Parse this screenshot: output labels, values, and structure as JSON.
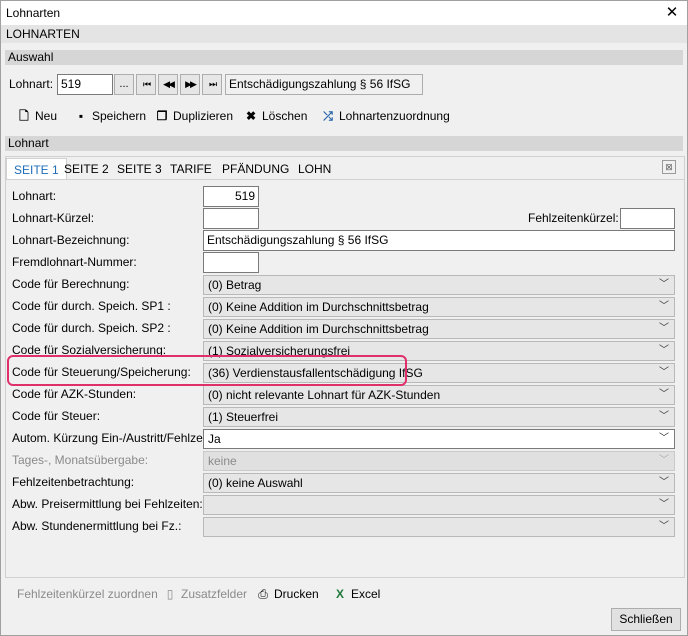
{
  "window": {
    "title": "Lohnarten",
    "close_glyph": "✕"
  },
  "header": {
    "label": "LOHNARTEN"
  },
  "auswahl": {
    "section_label": "Auswahl",
    "lohnart_label": "Lohnart:",
    "lohnart_value": "519",
    "browse_label": "...",
    "nav": [
      "⏮",
      "◀◀",
      "▶▶",
      "⏭"
    ],
    "description": "Entschädigungszahlung § 56 IfSG"
  },
  "toolbar": {
    "neu": "Neu",
    "speichern": "Speichern",
    "duplizieren": "Duplizieren",
    "loeschen": "Löschen",
    "zuordnung": "Lohnartenzuordnung"
  },
  "lohnart_section": {
    "label": "Lohnart"
  },
  "tabs": [
    "SEITE 1",
    "SEITE 2",
    "SEITE 3",
    "TARIFE",
    "PFÄNDUNG",
    "LOHN"
  ],
  "form": {
    "lohnart_label": "Lohnart:",
    "lohnart_value": "519",
    "kuerzel_label": "Lohnart-Kürzel:",
    "kuerzel_value": "",
    "fehlzeiten_label": "Fehlzeitenkürzel:",
    "fehlzeiten_value": "",
    "bezeichnung_label": "Lohnart-Bezeichnung:",
    "bezeichnung_value": "Entschädigungszahlung § 56 IfSG",
    "fremd_label": "Fremdlohnart-Nummer:",
    "fremd_value": "",
    "rows": [
      {
        "label": "Code für Berechnung:",
        "value": "(0) Betrag"
      },
      {
        "label": "Code für durch. Speich. SP1 :",
        "value": "(0) Keine Addition im Durchschnittsbetrag"
      },
      {
        "label": "Code für durch. Speich. SP2 :",
        "value": "(0) Keine Addition im Durchschnittsbetrag"
      },
      {
        "label": "Code für Sozialversicherung:",
        "value": "(1) Sozialversicherungsfrei"
      },
      {
        "label": "Code für Steuerung/Speicherung:",
        "value": "(36) Verdienstausfallentschädigung IfSG"
      },
      {
        "label": "Code für AZK-Stunden:",
        "value": "(0) nicht relevante Lohnart für AZK-Stunden"
      },
      {
        "label": "Code für Steuer:",
        "value": "(1) Steuerfrei"
      },
      {
        "label": "Autom. Kürzung Ein-/Austritt/Fehlzeit:",
        "value": "Ja"
      },
      {
        "label": "Tages-, Monatsübergabe:",
        "value": "keine"
      },
      {
        "label": "Fehlzeitenbetrachtung:",
        "value": "(0) keine Auswahl"
      },
      {
        "label": "Abw. Preisermittlung bei Fehlzeiten:",
        "value": ""
      },
      {
        "label": "Abw. Stundenermittlung bei Fz.:",
        "value": ""
      }
    ]
  },
  "bottom": {
    "fehlzeiten": "Fehlzeitenkürzel zuordnen",
    "zusatz": "Zusatzfelder",
    "drucken": "Drucken",
    "excel": "Excel",
    "schliessen": "Schließen"
  },
  "colors": {
    "highlight": "#e0306a",
    "active_tab": "#1e6db8"
  }
}
